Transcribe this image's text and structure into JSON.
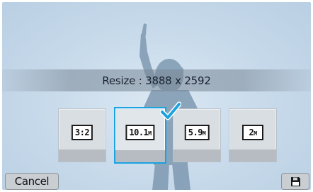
{
  "dialog": {
    "title": "Resize : 3888 x 2592"
  },
  "options": [
    {
      "label": "3:2",
      "icon": "aspect-3-2-icon",
      "selected": false
    },
    {
      "label": "10.1M",
      "main": "10.1",
      "unit": "M",
      "icon": "size-10-1m-icon",
      "selected": true
    },
    {
      "label": "5.9M",
      "main": "5.9",
      "unit": "M",
      "icon": "size-5-9m-icon",
      "selected": false
    },
    {
      "label": "2M",
      "main": "2",
      "unit": "M",
      "icon": "size-2m-icon",
      "selected": false
    }
  ],
  "buttons": {
    "cancel_label": "Cancel",
    "save_icon": "floppy-disk-icon"
  },
  "colors": {
    "selection": "#1aa3e0",
    "background": "#c5d9ea"
  }
}
